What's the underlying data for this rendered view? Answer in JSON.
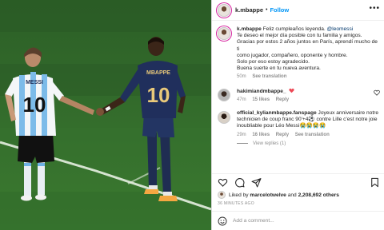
{
  "post": {
    "username": "k.mbappe",
    "follow_label": "Follow",
    "dot": "•"
  },
  "caption": {
    "username": "k.mbappe",
    "text_before_mention": "Feliz cumpleaños leyenda. ",
    "mention": "@leomessi",
    "text_after": "\nTe deseo el mejor día posible con tu familia y amigos.\nGracias por estos 2 años juntos en París, aprendí mucho de ti\ncomo jugador, compañero, oponente y hombre.\nSolo por eso estoy agradecido.\nBuena suerte en tu nueva aventura.",
    "time": "50m",
    "see_translation": "See translation"
  },
  "comments": [
    {
      "username": "hakimiandmbappe_",
      "time": "47m",
      "likes": "15 likes",
      "reply": "Reply"
    },
    {
      "username": "official_kylianmbappe.fanspage",
      "text": "Joyeux anniversaire notre\ntechnicien de coup franc 90'+4⚽ contre Lille c'est notre joie\ninoubliable pour Léo Messi",
      "emojis": "😭😭😭😭",
      "time": "29m",
      "likes": "16 likes",
      "reply": "Reply",
      "see_translation": "See translation",
      "view_replies": "View replies (1)"
    }
  ],
  "likes": {
    "prefix": "Liked by ",
    "user": "marcelotwelve",
    "middle": " and ",
    "count": "2,208,692 others"
  },
  "time_ago": "36 MINUTES AGO",
  "add_comment": {
    "placeholder": "Add a comment..."
  },
  "photo": {
    "player_left_name": "MESSI",
    "player_left_number": "10",
    "player_right_name": "MBAPPE",
    "player_right_number": "10"
  },
  "colors": {
    "follow": "#0095f6",
    "pitch": "#2f6a2a",
    "heart": "#ed4956"
  },
  "icons": [
    "more-icon",
    "heart-icon",
    "comment-icon",
    "share-icon",
    "bookmark-icon",
    "emoji-icon"
  ]
}
